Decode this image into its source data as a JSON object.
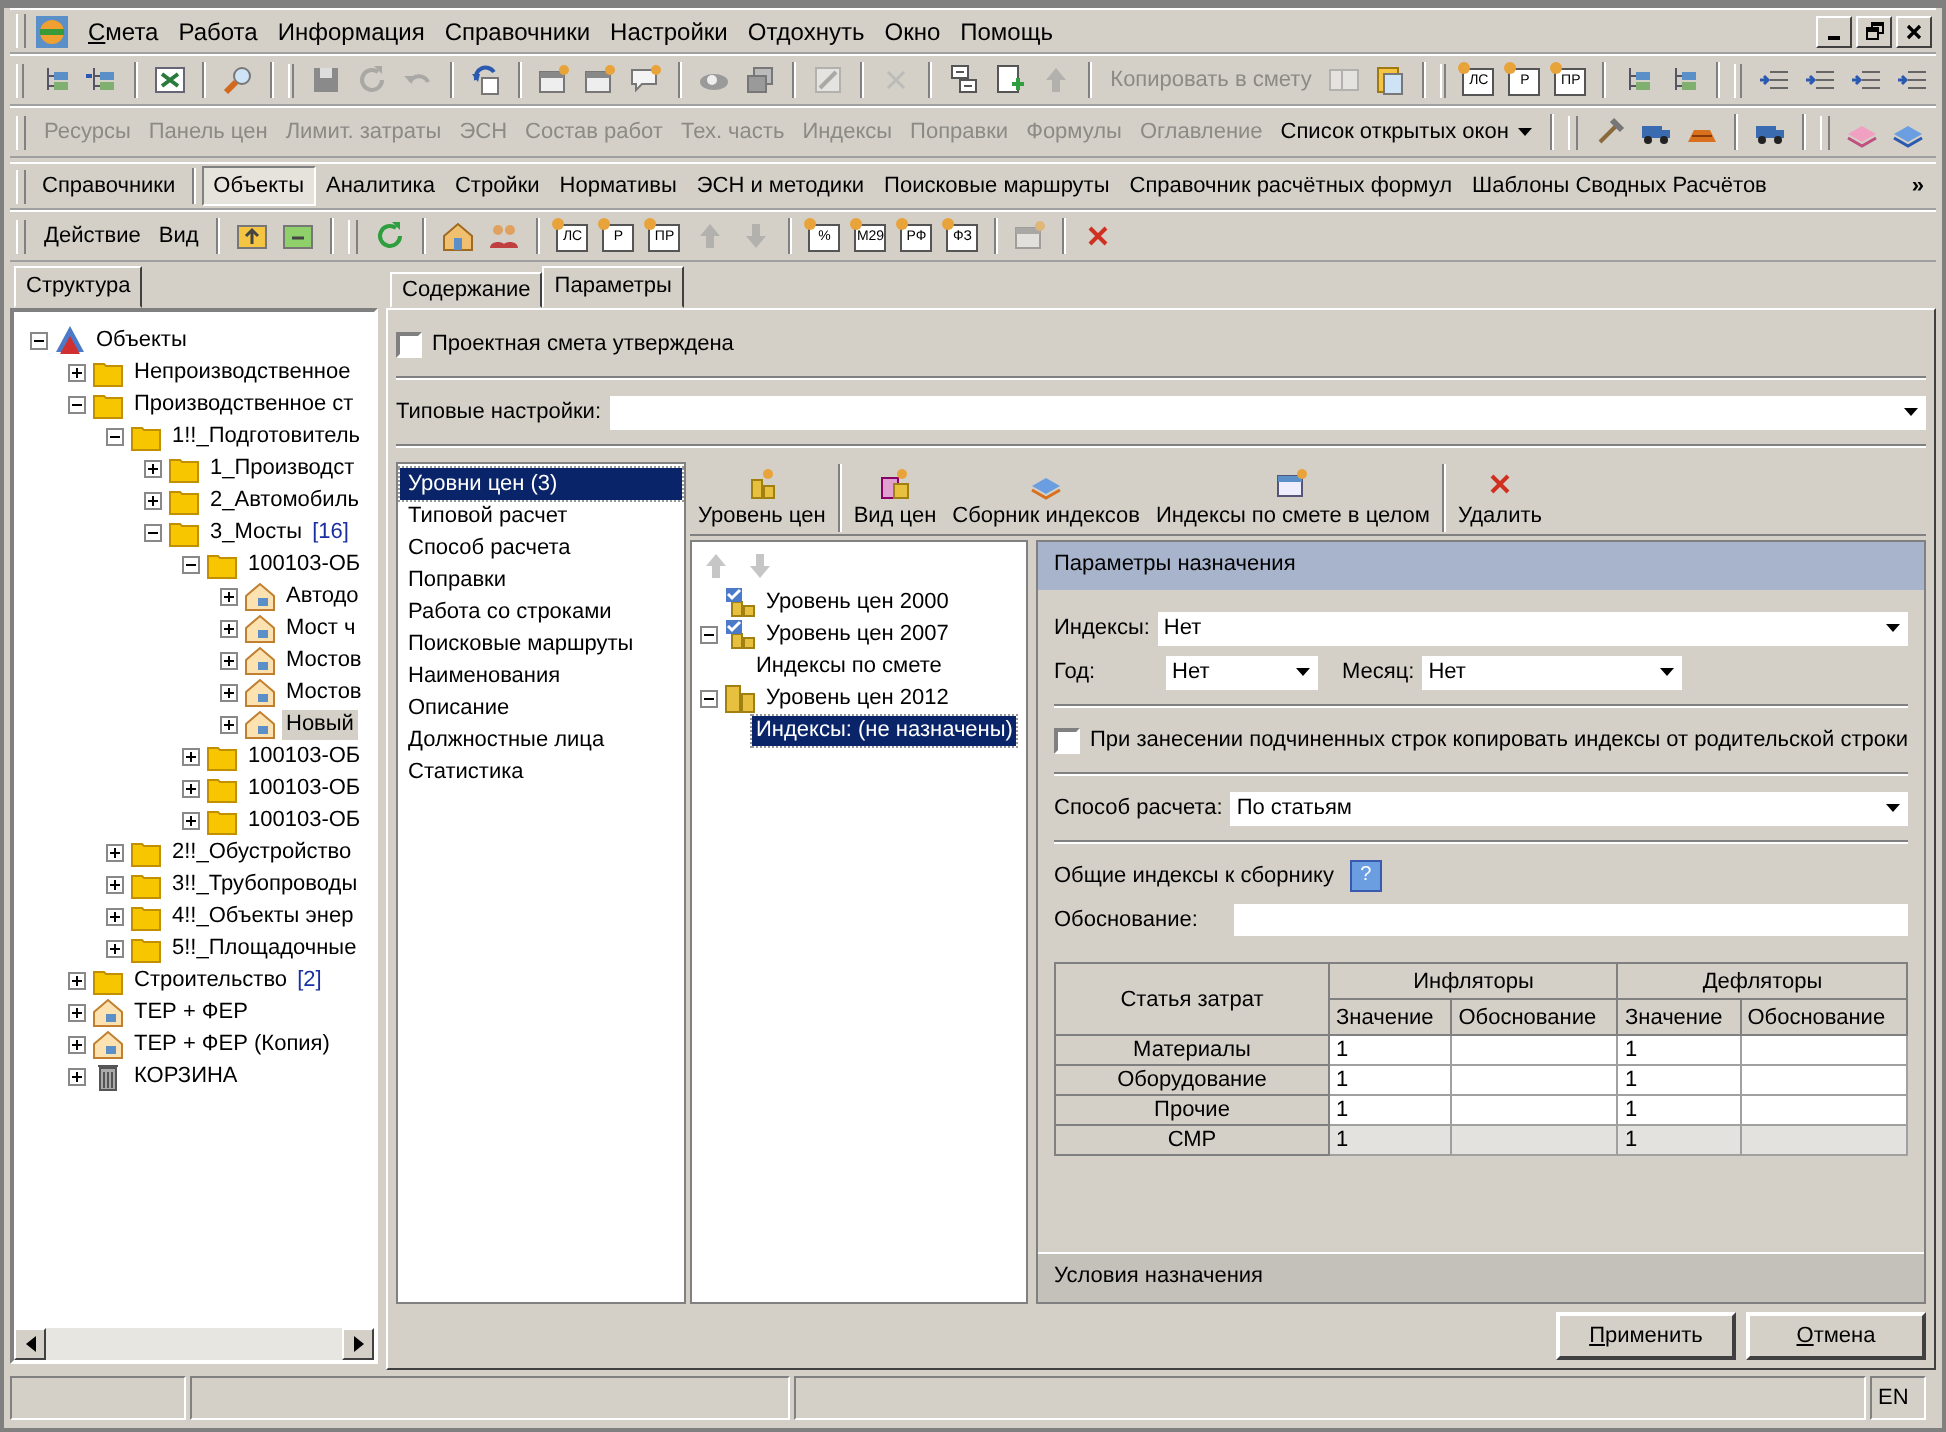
{
  "menu": {
    "items": [
      {
        "label": "Смета",
        "mnemonic": true
      },
      {
        "label": "Работа",
        "mnemonic": false
      },
      {
        "label": "Информация",
        "mnemonic": false
      },
      {
        "label": "Справочники",
        "mnemonic": false
      },
      {
        "label": "Настройки",
        "mnemonic": false
      },
      {
        "label": "Отдохнуть",
        "mnemonic": false
      },
      {
        "label": "Окно",
        "mnemonic": false
      },
      {
        "label": "Помощь",
        "mnemonic": false
      }
    ]
  },
  "toolbar_main": {
    "copy_button": {
      "label": "Копировать в смету",
      "disabled": true
    },
    "doc_icons": [
      "ЛС",
      "Р",
      "ПР"
    ]
  },
  "toolbar_modules": {
    "items": [
      {
        "label": "Ресурсы",
        "disabled": true
      },
      {
        "label": "Панель цен",
        "disabled": true
      },
      {
        "label": "Лимит. затраты",
        "disabled": true
      },
      {
        "label": "ЭСН",
        "disabled": true
      },
      {
        "label": "Состав работ",
        "disabled": true
      },
      {
        "label": "Тех. часть",
        "disabled": true
      },
      {
        "label": "Индексы",
        "disabled": true
      },
      {
        "label": "Поправки",
        "disabled": true
      },
      {
        "label": "Формулы",
        "disabled": true
      },
      {
        "label": "Оглавление",
        "disabled": true
      }
    ],
    "windows_list": "Список открытых окон"
  },
  "nav_tabs": [
    {
      "label": "Справочники",
      "selected": false
    },
    {
      "label": "Объекты",
      "selected": true
    },
    {
      "label": "Аналитика",
      "selected": false
    },
    {
      "label": "Стройки",
      "selected": false
    },
    {
      "label": "Нормативы",
      "selected": false
    },
    {
      "label": "ЭСН и методики",
      "selected": false
    },
    {
      "label": "Поисковые маршруты",
      "selected": false
    },
    {
      "label": "Справочник расчётных формул",
      "selected": false
    },
    {
      "label": "Шаблоны Сводных Расчётов",
      "selected": false
    }
  ],
  "nav_more": "»",
  "toolbar_objects": {
    "menus": [
      "Действие",
      "Вид"
    ],
    "doc_icons": [
      "ЛС",
      "Р",
      "ПР"
    ],
    "index_icons": [
      "%",
      "М29",
      "РФ",
      "ФЗ"
    ]
  },
  "structure_tab": "Структура",
  "tree": [
    {
      "label": "Объекты",
      "kind": "root",
      "expanded": true,
      "selected": false,
      "children": [
        {
          "label": "Непроизводственное",
          "kind": "folder",
          "expanded": false,
          "selected": false
        },
        {
          "label": "Производственное ст",
          "kind": "folder",
          "expanded": true,
          "selected": false,
          "children": [
            {
              "label": "1!!_Подготовитель",
              "kind": "folder",
              "expanded": true,
              "selected": false,
              "children": [
                {
                  "label": "1_Производст",
                  "kind": "folder",
                  "expanded": false,
                  "selected": false
                },
                {
                  "label": "2_Автомобиль",
                  "kind": "folder",
                  "expanded": false,
                  "selected": false
                },
                {
                  "label": "3_Мосты",
                  "count": "[16]",
                  "kind": "folder",
                  "expanded": true,
                  "selected": false,
                  "children": [
                    {
                      "label": "100103-ОБ",
                      "kind": "folder",
                      "expanded": true,
                      "selected": false,
                      "children": [
                        {
                          "label": "Автодо",
                          "kind": "object",
                          "expanded": false,
                          "selected": false
                        },
                        {
                          "label": "Мост ч",
                          "kind": "object",
                          "expanded": false,
                          "selected": false
                        },
                        {
                          "label": "Мостов",
                          "kind": "object",
                          "expanded": false,
                          "selected": false
                        },
                        {
                          "label": "Мостов",
                          "kind": "object",
                          "expanded": false,
                          "selected": false
                        },
                        {
                          "label": "Новый",
                          "kind": "object",
                          "expanded": false,
                          "selected": true
                        }
                      ]
                    },
                    {
                      "label": "100103-ОБ",
                      "kind": "folder",
                      "expanded": false,
                      "selected": false
                    },
                    {
                      "label": "100103-ОБ",
                      "kind": "folder",
                      "expanded": false,
                      "selected": false
                    },
                    {
                      "label": "100103-ОБ",
                      "kind": "folder",
                      "expanded": false,
                      "selected": false
                    }
                  ]
                }
              ]
            },
            {
              "label": "2!!_Обустройство",
              "kind": "folder",
              "expanded": false,
              "selected": false
            },
            {
              "label": "3!!_Трубопроводы",
              "kind": "folder",
              "expanded": false,
              "selected": false
            },
            {
              "label": "4!!_Объекты энер",
              "kind": "folder",
              "expanded": false,
              "selected": false
            },
            {
              "label": "5!!_Площадочные",
              "kind": "folder",
              "expanded": false,
              "selected": false
            }
          ]
        },
        {
          "label": "Строительство",
          "count": "[2]",
          "kind": "folder",
          "expanded": false,
          "selected": false
        },
        {
          "label": "ТЕР + ФЕР",
          "kind": "object",
          "expanded": false,
          "selected": false
        },
        {
          "label": "ТЕР + ФЕР (Копия)",
          "kind": "object",
          "expanded": false,
          "selected": false
        },
        {
          "label": "КОРЗИНА",
          "kind": "trash",
          "expanded": false,
          "selected": false
        }
      ]
    }
  ],
  "content_tabs": [
    {
      "label": "Содержание",
      "selected": false
    },
    {
      "label": "Параметры",
      "selected": true
    }
  ],
  "approved_checkbox": {
    "label": "Проектная смета утверждена",
    "checked": false
  },
  "typical_settings": {
    "label": "Типовые настройки:"
  },
  "sections": [
    {
      "label": "Уровни цен (3)",
      "selected": true
    },
    {
      "label": "Типовой расчет",
      "selected": false
    },
    {
      "label": "Способ расчета",
      "selected": false
    },
    {
      "label": "Поправки",
      "selected": false
    },
    {
      "label": "Работа со строками",
      "selected": false
    },
    {
      "label": "Поисковые маршруты",
      "selected": false
    },
    {
      "label": "Наименования",
      "selected": false
    },
    {
      "label": "Описание",
      "selected": false
    },
    {
      "label": "Должностные лица",
      "selected": false
    },
    {
      "label": "Статистика",
      "selected": false
    }
  ],
  "level_toolbar": [
    {
      "label": "Уровень цен",
      "kind": "level"
    },
    {
      "label": "Вид цен",
      "kind": "view"
    },
    {
      "label": "Сборник индексов",
      "kind": "collection"
    },
    {
      "label": "Индексы по смете в целом",
      "kind": "indexes"
    },
    {
      "label": "Удалить",
      "kind": "delete"
    }
  ],
  "level_tree": [
    {
      "label": "Уровень цен 2000",
      "checked": true,
      "selected": false
    },
    {
      "label": "Уровень цен 2007",
      "checked": true,
      "expanded": true,
      "selected": false,
      "children": [
        {
          "label": "Индексы по смете",
          "selected": false
        }
      ]
    },
    {
      "label": "Уровень цен 2012",
      "checked": false,
      "expanded": true,
      "selected": false,
      "children": [
        {
          "label": "Индексы: (не назначены)",
          "selected": true
        }
      ]
    }
  ],
  "assign_panel": {
    "title": "Параметры назначения",
    "indexes": {
      "label": "Индексы:",
      "value": "Нет"
    },
    "year": {
      "label": "Год:",
      "value": "Нет"
    },
    "month": {
      "label": "Месяц:",
      "value": "Нет"
    },
    "copy_checkbox": {
      "label": "При занесении подчиненных строк копировать индексы от родительской строки",
      "checked": false
    },
    "method": {
      "label": "Способ расчета:",
      "value": "По статьям"
    },
    "common_indexes": {
      "label": "Общие индексы к сборнику",
      "help": "?"
    },
    "basis": {
      "label": "Обоснование:"
    },
    "table": {
      "item_header": "Статья затрат",
      "groups": [
        "Инфляторы",
        "Дефляторы"
      ],
      "subcolumns": [
        "Значение",
        "Обоснование",
        "Значение",
        "Обоснование"
      ],
      "rows": [
        {
          "item": "Материалы",
          "inflator": "1",
          "deflator": "1",
          "disabled": false
        },
        {
          "item": "Оборудование",
          "inflator": "1",
          "deflator": "1",
          "disabled": false
        },
        {
          "item": "Прочие",
          "inflator": "1",
          "deflator": "1",
          "disabled": false
        },
        {
          "item": "СМР",
          "inflator": "1",
          "deflator": "1",
          "disabled": true
        }
      ]
    },
    "footer": "Условия назначения"
  },
  "buttons": [
    {
      "label": "Применить",
      "mnemonic": true
    },
    {
      "label": "Отмена",
      "mnemonic": true
    }
  ],
  "status_bar": {
    "language": "EN"
  }
}
